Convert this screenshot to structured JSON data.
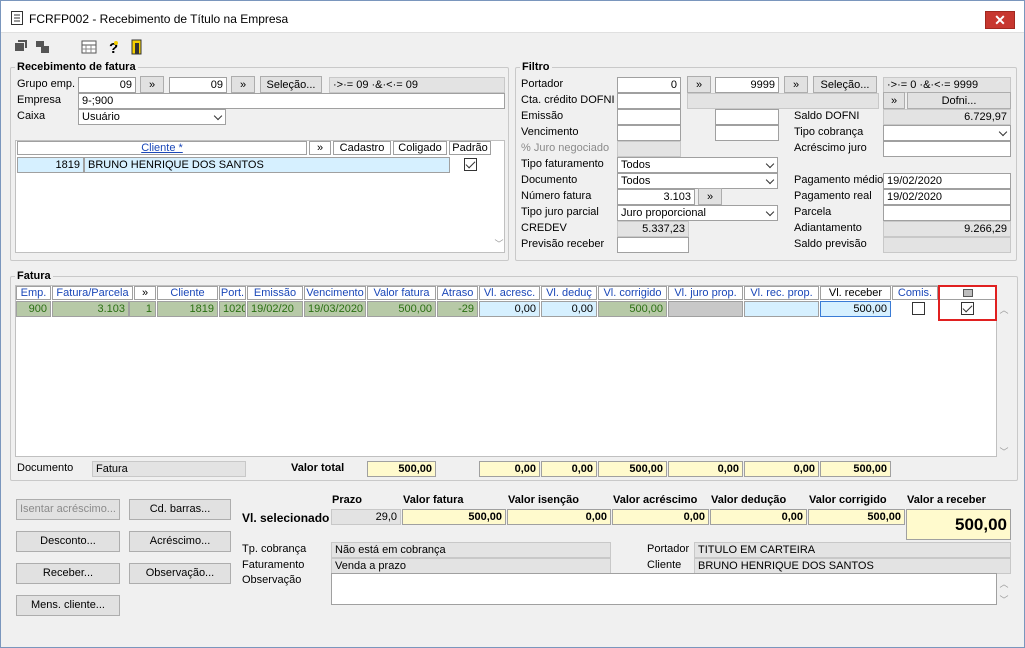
{
  "window": {
    "title": "FCRFP002 - Recebimento de Título na Empresa",
    "close_label": "✕"
  },
  "toolbar": {
    "icons": [
      "open-icon",
      "copy-icon",
      "calendar-icon",
      "help-icon",
      "exit-icon"
    ]
  },
  "recebimento": {
    "legend": "Recebimento de fatura",
    "grupo_label": "Grupo emp.",
    "grupo_from": "09",
    "grupo_to": "09",
    "grupo_range": "·>·= 09 ·&·<·= 09",
    "empresa_label": "Empresa",
    "empresa_value": "9-;900",
    "caixa_label": "Caixa",
    "caixa_value": "Usuário",
    "selecao_label": "Seleção...",
    "more_label": "»",
    "cliente_headers": {
      "cliente": "Cliente *",
      "cadastro": "Cadastro",
      "coligado": "Coligado",
      "padrao": "Padrão"
    },
    "cliente_row": {
      "code": "1819",
      "name": "BRUNO HENRIQUE DOS SANTOS",
      "padrao": true
    }
  },
  "filtro": {
    "legend": "Filtro",
    "portador_label": "Portador",
    "portador_from": "0",
    "portador_to": "9999",
    "portador_range": "·>·= 0 ·&·<·= 9999",
    "cta_label": "Cta. crédito DOFNI",
    "dofni_label": "Dofni...",
    "emissao_label": "Emissão",
    "vencimento_label": "Vencimento",
    "juro_neg_label": "% Juro negociado",
    "tipo_fat_label": "Tipo faturamento",
    "tipo_fat_value": "Todos",
    "documento_label": "Documento",
    "documento_value": "Todos",
    "numero_fatura_label": "Número fatura",
    "numero_fatura_value": "3.103",
    "tipo_juro_label": "Tipo juro parcial",
    "tipo_juro_value": "Juro proporcional",
    "credev_label": "CREDEV",
    "credev_value": "5.337,23",
    "prev_receber_label": "Previsão receber",
    "saldo_dofni_label": "Saldo DOFNI",
    "saldo_dofni_value": "6.729,97",
    "tipo_cobranca_label": "Tipo cobrança",
    "acrescimo_juro_label": "Acréscimo juro",
    "pag_medio_label": "Pagamento médio",
    "pag_medio_value": "19/02/2020",
    "pag_real_label": "Pagamento real",
    "pag_real_value": "19/02/2020",
    "parcela_label": "Parcela",
    "adiantamento_label": "Adiantamento",
    "adiantamento_value": "9.266,29",
    "saldo_prev_label": "Saldo previsão"
  },
  "fatura": {
    "legend": "Fatura",
    "headers": [
      "Emp.",
      "Fatura/Parcela",
      "»",
      "Cliente",
      "Port.",
      "Emissão",
      "Vencimento",
      "Valor fatura",
      "Atraso",
      "Vl. acresc.",
      "Vl. deduç",
      "Vl. corrigido",
      "Vl. juro prop.",
      "Vl. rec. prop.",
      "Vl. receber",
      "Comis."
    ],
    "row": {
      "emp": "900",
      "fatura": "3.103",
      "parcela": "1",
      "cliente": "1819",
      "port": "1020",
      "emissao": "19/02/20",
      "vencimento": "19/03/2020",
      "valor_fatura": "500,00",
      "atraso": "-29",
      "acresc": "0,00",
      "deduc": "0,00",
      "corrigido": "500,00",
      "juro_prop": "",
      "rec_prop": "",
      "receber": "500,00",
      "comis": false,
      "selected": true
    },
    "documento_label": "Documento",
    "documento_value": "Fatura",
    "valor_total_label": "Valor total",
    "totals": {
      "valor": "500,00",
      "acresc": "0,00",
      "deduc": "0,00",
      "corrigido": "500,00",
      "juro": "0,00",
      "rec": "0,00",
      "receber": "500,00"
    }
  },
  "summary": {
    "headers": {
      "prazo": "Prazo",
      "valor_fatura": "Valor fatura",
      "valor_isencao": "Valor isenção",
      "valor_acrescimo": "Valor acréscimo",
      "valor_deducao": "Valor dedução",
      "valor_corrigido": "Valor corrigido",
      "valor_receber": "Valor a receber"
    },
    "vl_selecionado_label": "Vl. selecionado",
    "values": {
      "prazo": "29,0",
      "valor_fatura": "500,00",
      "valor_isencao": "0,00",
      "valor_acrescimo": "0,00",
      "valor_deducao": "0,00",
      "valor_corrigido": "500,00",
      "valor_receber": "500,00"
    },
    "tp_cobranca_label": "Tp. cobrança",
    "tp_cobranca_value": "Não está em cobrança",
    "faturamento_label": "Faturamento",
    "faturamento_value": "Venda a prazo",
    "observacao_label": "Observação",
    "portador_label": "Portador",
    "portador_value": "TITULO EM CARTEIRA",
    "cliente_label": "Cliente",
    "cliente_value": "BRUNO HENRIQUE DOS SANTOS"
  },
  "buttons": {
    "isentar": "Isentar acréscimo...",
    "cd_barras": "Cd. barras...",
    "desconto": "Desconto...",
    "acrescimo": "Acréscimo...",
    "receber": "Receber...",
    "observacao": "Observação...",
    "mens_cliente": "Mens. cliente..."
  },
  "colors": {
    "highlight_border": "#e02020",
    "green_text": "#2a6f12",
    "header_blue": "#1a47b8"
  }
}
